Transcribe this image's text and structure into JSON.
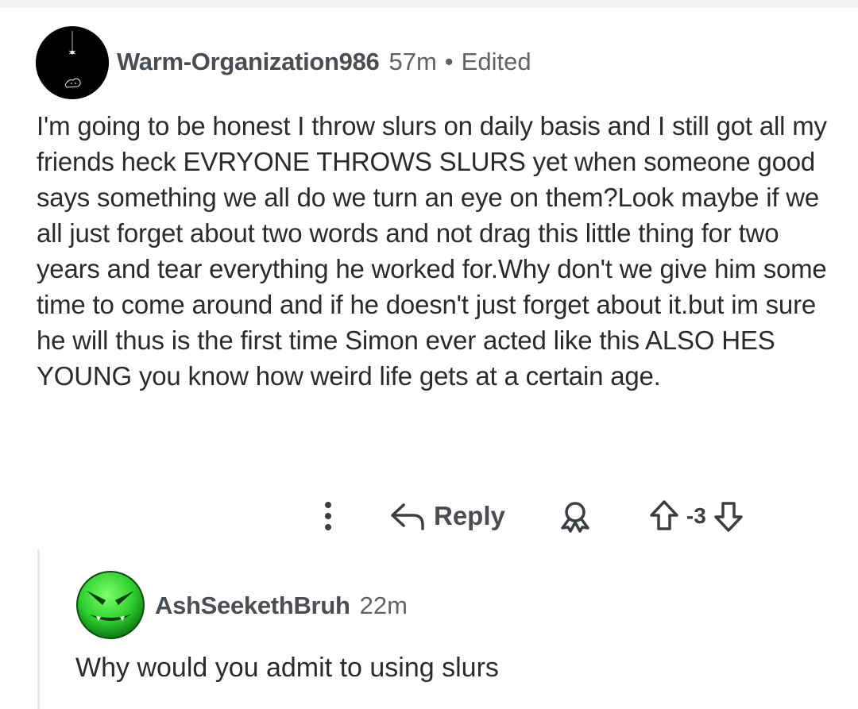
{
  "comment": {
    "username": "Warm-Organization986",
    "time": "57m",
    "separator": "•",
    "edited": "Edited",
    "body": "I'm going to be honest I throw slurs on daily basis and I still got all my friends heck EVRYONE THROWS SLURS yet when someone good says something we all do we turn an eye on them?Look maybe if we all just forget about two words and not drag this little thing for two years and tear everything he worked for.Why don't we give him some time to come around and if he doesn't just forget about it.but im sure he will thus is the first time Simon ever acted like this ALSO HES YOUNG you know how weird life gets at a certain age."
  },
  "actions": {
    "reply_label": "Reply",
    "score": "-3",
    "icons": [
      "more-vertical-icon",
      "reply-arrow-icon",
      "award-icon",
      "upvote-arrow-icon",
      "downvote-arrow-icon"
    ]
  },
  "reply": {
    "username": "AshSeekethBruh",
    "time": "22m",
    "body": "Why would you admit to using slurs"
  },
  "colors": {
    "background": "#ffffff",
    "text": "#2a2b2d",
    "meta": "#5f6266",
    "username": "#4a4d52",
    "thread_line": "#e6e7e9",
    "reply_avatar": "#2fd12f"
  }
}
